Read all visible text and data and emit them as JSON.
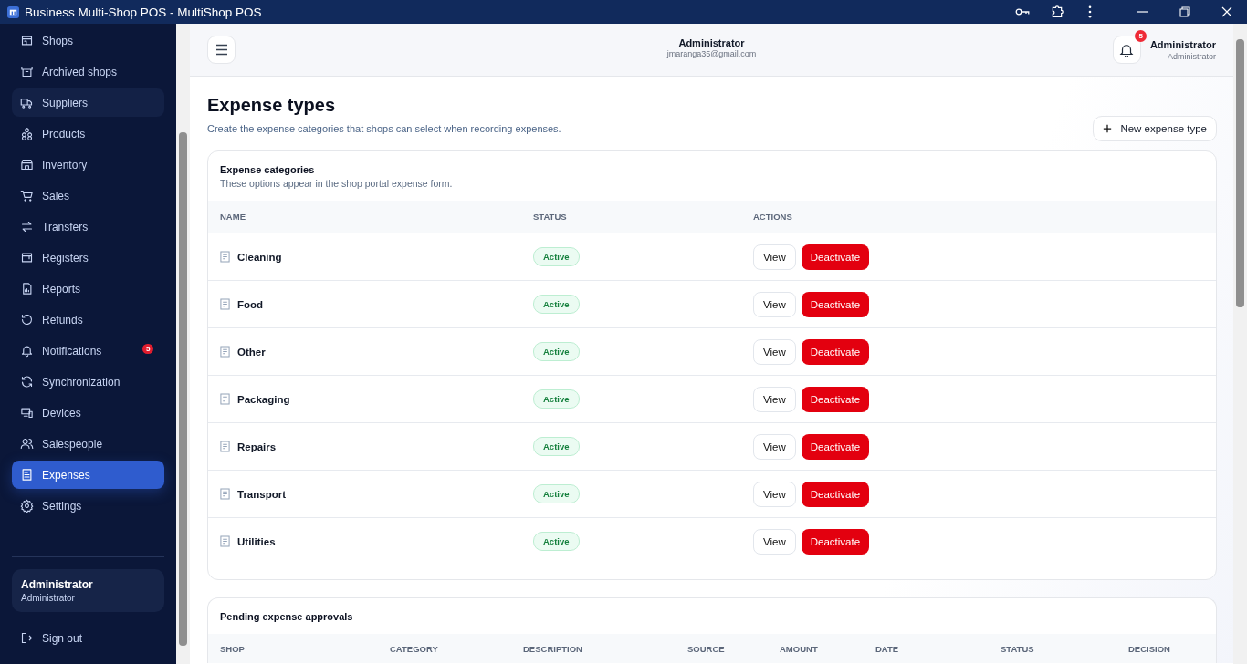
{
  "window": {
    "title": "Business Multi-Shop POS - MultiShop POS"
  },
  "sidebar": {
    "items": [
      {
        "label": "Shops",
        "selected": false,
        "hovered": false
      },
      {
        "label": "Archived shops",
        "selected": false,
        "hovered": false
      },
      {
        "label": "Suppliers",
        "selected": false,
        "hovered": true
      },
      {
        "label": "Products",
        "selected": false,
        "hovered": false
      },
      {
        "label": "Inventory",
        "selected": false,
        "hovered": false
      },
      {
        "label": "Sales",
        "selected": false,
        "hovered": false
      },
      {
        "label": "Transfers",
        "selected": false,
        "hovered": false
      },
      {
        "label": "Registers",
        "selected": false,
        "hovered": false
      },
      {
        "label": "Reports",
        "selected": false,
        "hovered": false
      },
      {
        "label": "Refunds",
        "selected": false,
        "hovered": false
      },
      {
        "label": "Notifications",
        "selected": false,
        "hovered": false,
        "badge": "5"
      },
      {
        "label": "Synchronization",
        "selected": false,
        "hovered": false
      },
      {
        "label": "Devices",
        "selected": false,
        "hovered": false
      },
      {
        "label": "Salespeople",
        "selected": false,
        "hovered": false
      },
      {
        "label": "Expenses",
        "selected": true,
        "hovered": false
      },
      {
        "label": "Settings",
        "selected": false,
        "hovered": false
      }
    ],
    "user": {
      "name": "Administrator",
      "role": "Administrator"
    },
    "sign_out": "Sign out"
  },
  "header": {
    "name": "Administrator",
    "email": "jmaranga35@gmail.com",
    "notification_count": "5",
    "user_name": "Administrator",
    "user_role": "Administrator"
  },
  "page": {
    "title": "Expense types",
    "subtitle": "Create the expense categories that shops can select when recording expenses.",
    "new_button": "New expense type"
  },
  "categories": {
    "title": "Expense categories",
    "subtitle": "These options appear in the shop portal expense form.",
    "columns": [
      "NAME",
      "STATUS",
      "ACTIONS"
    ],
    "rows": [
      {
        "name": "Cleaning",
        "status": "Active",
        "view": "View",
        "action": "Deactivate"
      },
      {
        "name": "Food",
        "status": "Active",
        "view": "View",
        "action": "Deactivate"
      },
      {
        "name": "Other",
        "status": "Active",
        "view": "View",
        "action": "Deactivate"
      },
      {
        "name": "Packaging",
        "status": "Active",
        "view": "View",
        "action": "Deactivate"
      },
      {
        "name": "Repairs",
        "status": "Active",
        "view": "View",
        "action": "Deactivate"
      },
      {
        "name": "Transport",
        "status": "Active",
        "view": "View",
        "action": "Deactivate"
      },
      {
        "name": "Utilities",
        "status": "Active",
        "view": "View",
        "action": "Deactivate"
      }
    ]
  },
  "approvals": {
    "title": "Pending expense approvals",
    "columns": [
      "SHOP",
      "CATEGORY",
      "DESCRIPTION",
      "SOURCE",
      "AMOUNT",
      "DATE",
      "STATUS",
      "DECISION"
    ]
  }
}
